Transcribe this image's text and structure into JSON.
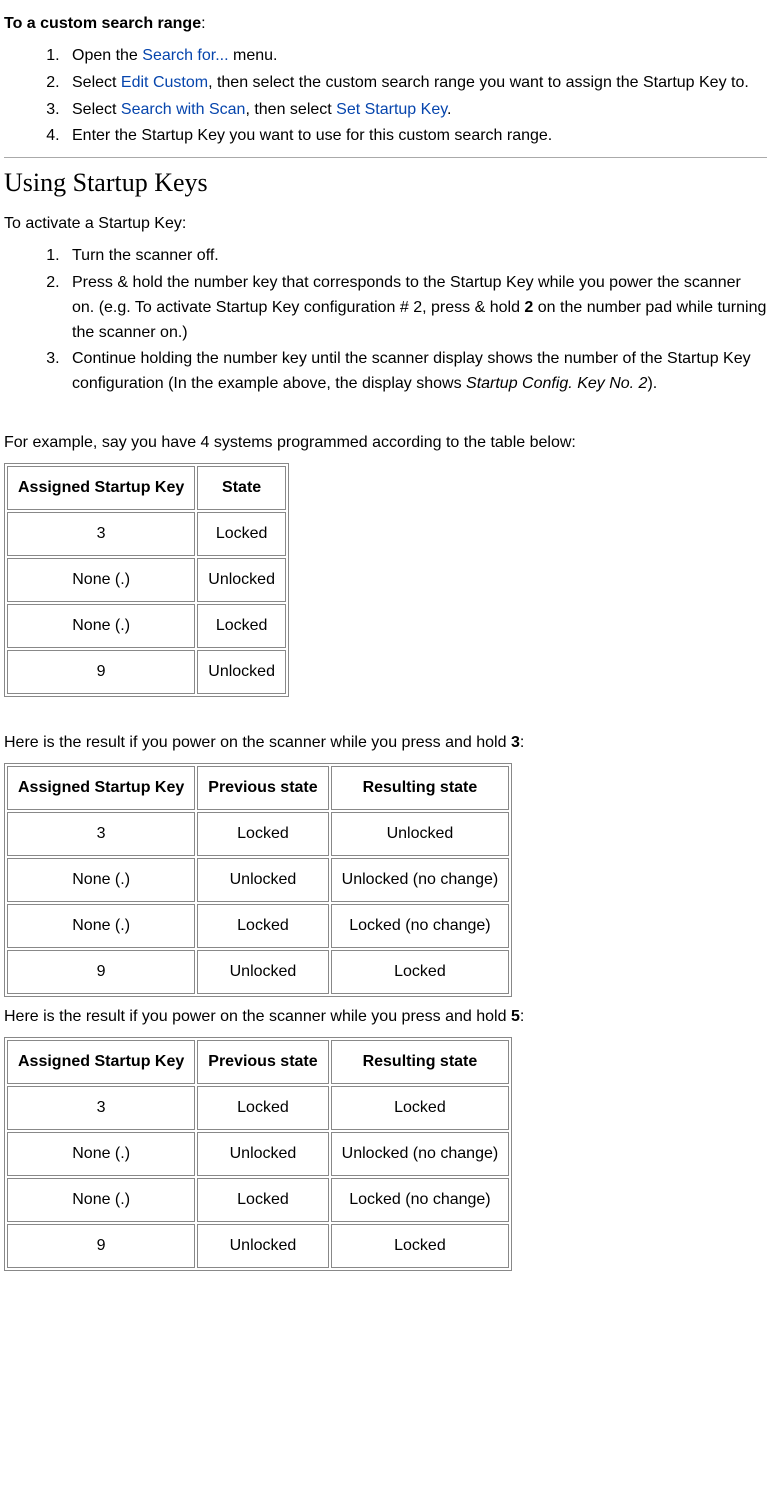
{
  "section_custom_title": "To a custom search range",
  "section_custom_title_suffix": ":",
  "custom_steps": [
    {
      "prefix": "Open the ",
      "link": "Search for...",
      "suffix": " menu."
    },
    {
      "prefix": "Select ",
      "link": "Edit Custom",
      "suffix": ", then select the custom search range you want to assign the Startup Key to."
    },
    {
      "prefix": "Select ",
      "link": "Search with Scan",
      "mid": ", then select ",
      "link2": "Set Startup Key",
      "suffix": "."
    },
    {
      "prefix": "Enter the Startup Key you want to use for this custom search range."
    }
  ],
  "using_heading": "Using Startup Keys",
  "activate_intro": "To activate a Startup Key:",
  "activate_steps": [
    "Turn the scanner off.",
    {
      "prefix": "Press & hold the number key that corresponds to the Startup Key while you power the scanner on. (e.g. To activate Startup Key configuration # 2, press & hold ",
      "bold": "2",
      "suffix": " on the number pad while turning the scanner on.)"
    },
    {
      "prefix": "Continue holding the number key until the scanner display shows the number of the Startup Key configuration (In the example above, the display shows ",
      "italic": "Startup Config. Key No. 2",
      "suffix": ")."
    }
  ],
  "example_intro": "For example, say you have 4 systems programmed according to the table below:",
  "table1": {
    "headers": [
      "Assigned Startup Key",
      "State"
    ],
    "rows": [
      [
        "3",
        "Locked"
      ],
      [
        "None (.)",
        "Unlocked"
      ],
      [
        "None (.)",
        "Locked"
      ],
      [
        "9",
        "Unlocked"
      ]
    ]
  },
  "result3_intro_prefix": "Here is the result if you power on the scanner while you press and hold ",
  "result3_intro_bold": "3",
  "result3_intro_suffix": ":",
  "table2": {
    "headers": [
      "Assigned Startup Key",
      "Previous state",
      "Resulting state"
    ],
    "rows": [
      [
        "3",
        "Locked",
        "Unlocked"
      ],
      [
        "None (.)",
        "Unlocked",
        "Unlocked (no change)"
      ],
      [
        "None (.)",
        "Locked",
        "Locked (no change)"
      ],
      [
        "9",
        "Unlocked",
        "Locked"
      ]
    ]
  },
  "result5_intro_prefix": "Here is the result if you power on the scanner while you press and hold ",
  "result5_intro_bold": "5",
  "result5_intro_suffix": ":",
  "table3": {
    "headers": [
      "Assigned Startup Key",
      "Previous state",
      "Resulting state"
    ],
    "rows": [
      [
        "3",
        "Locked",
        "Locked"
      ],
      [
        "None (.)",
        "Unlocked",
        "Unlocked (no change)"
      ],
      [
        "None (.)",
        "Locked",
        "Locked (no change)"
      ],
      [
        "9",
        "Unlocked",
        "Locked"
      ]
    ]
  }
}
